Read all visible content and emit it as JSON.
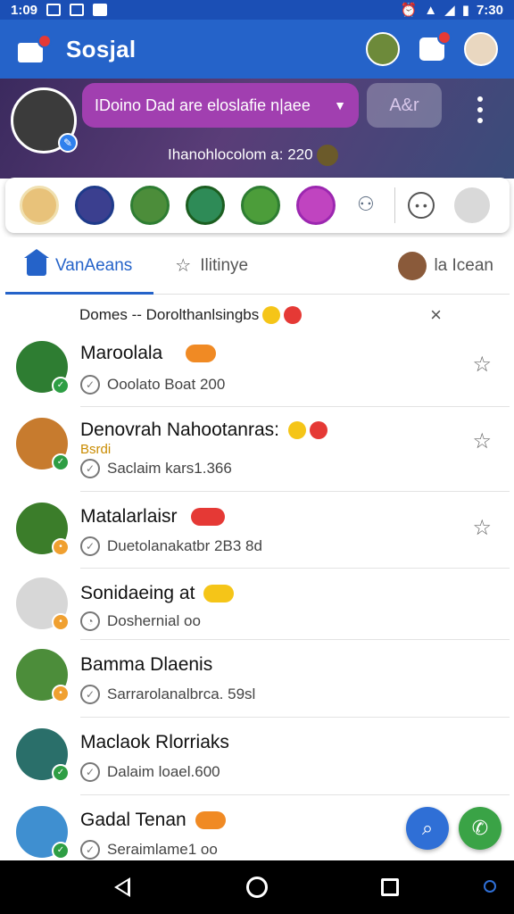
{
  "status_bar": {
    "time": "1:09",
    "right_time": "7:30"
  },
  "app": {
    "title": "Sosjal"
  },
  "banner": {
    "status_text": "IDoino Dad are eloslafie n|aee",
    "action_label": "A&r",
    "subtitle": "Ihanohlocolom a: 220"
  },
  "tabs": [
    {
      "label": "VanAeans",
      "icon": "home-icon"
    },
    {
      "label": "Ilitinye",
      "icon": "star-icon"
    }
  ],
  "tab_right": {
    "label": "la Icean"
  },
  "notice": {
    "text": "Domes -- Dorolthanlsingbs",
    "close": "×"
  },
  "contacts": [
    {
      "name": "Maroolala",
      "sub": "Ooolato Boat 200",
      "extra": "",
      "avatar_color": "#2e7d32",
      "badge_color": "#2e9e44"
    },
    {
      "name": "Denovrah Nahootanras:",
      "sub": "Saclaim kars1.366",
      "extra": "Bsrdi",
      "avatar_color": "#c77b2e",
      "badge_color": "#2e9e44"
    },
    {
      "name": "Matalarlaisr",
      "sub": "Duetolanakatbr 2B3 8d",
      "extra": "",
      "avatar_color": "#3b7d2a",
      "badge_color": "#f0a030"
    },
    {
      "name": "Sonidaeing at",
      "sub": "Doshernial oo",
      "extra": "",
      "avatar_color": "#d7d7d7",
      "badge_color": "#f0a030"
    },
    {
      "name": "Bamma Dlaenis",
      "sub": "Sarrarolanalbrca. 59sl",
      "extra": "",
      "avatar_color": "#4c8d3a",
      "badge_color": "#f0a030"
    },
    {
      "name": "Maclaok Rlorriaks",
      "sub": "Dalaim loael.600",
      "extra": "",
      "avatar_color": "#2a6f6a",
      "badge_color": "#2e9e44"
    },
    {
      "name": "Gadal Tenan",
      "sub": "Seraimlame1 oo",
      "extra": "",
      "avatar_color": "#3f8fd0",
      "badge_color": "#2e9e44"
    }
  ],
  "stories_avatar_colors": [
    "#e8c27a",
    "#3b3f8f",
    "#4c8d3a",
    "#2e8b57",
    "#4c9d3a",
    "#c044c0"
  ],
  "colors": {
    "primary": "#2563c9",
    "accent_purple": "#a13fb0",
    "fab_blue": "#2f6fd6",
    "fab_green": "#3aa346"
  }
}
